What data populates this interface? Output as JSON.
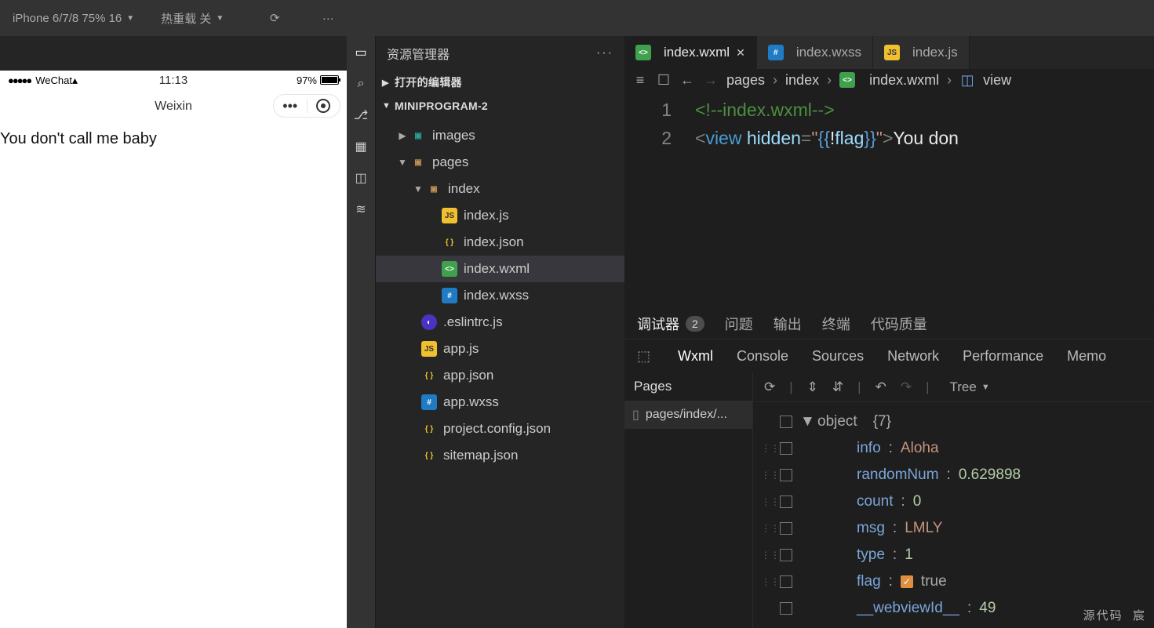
{
  "topbar": {
    "device": "iPhone 6/7/8 75% 16",
    "hotreload": "热重载 关"
  },
  "simulator": {
    "statusbar": {
      "carrier": "WeChat",
      "time": "11:13",
      "battery": "97%"
    },
    "navbar": {
      "title": "Weixin"
    },
    "page_text": "You don't call me baby"
  },
  "explorer": {
    "title": "资源管理器",
    "open_editors": "打开的编辑器",
    "project": "MINIPROGRAM-2",
    "tree": {
      "images": "images",
      "pages": "pages",
      "index_dir": "index",
      "files": {
        "index_js": "index.js",
        "index_json": "index.json",
        "index_wxml": "index.wxml",
        "index_wxss": "index.wxss",
        "eslintrc": ".eslintrc.js",
        "app_js": "app.js",
        "app_json": "app.json",
        "app_wxss": "app.wxss",
        "project_config": "project.config.json",
        "sitemap": "sitemap.json"
      }
    }
  },
  "editor": {
    "tabs": {
      "wxml": "index.wxml",
      "wxss": "index.wxss",
      "js": "index.js"
    },
    "breadcrumb": {
      "p0": "pages",
      "p1": "index",
      "p2": "index.wxml",
      "p3": "view"
    },
    "code": {
      "l1_num": "1",
      "l2_num": "2",
      "l1": "<!--index.wxml-->",
      "l2_pre": "<",
      "l2_tag": "view",
      "l2_sp": " ",
      "l2_attr": "hidden",
      "l2_eq": "=",
      "l2_q1": "\"",
      "l2_bo": "{{",
      "l2_not": "!",
      "l2_flag": "flag",
      "l2_bc": "}}",
      "l2_q2": "\"",
      "l2_gt": ">",
      "l2_txt": "You don"
    }
  },
  "panel": {
    "debugger": "调试器",
    "debugger_badge": "2",
    "problems": "问题",
    "output": "输出",
    "terminal": "终端",
    "codequality": "代码质量"
  },
  "devtools": {
    "tabs": {
      "wxml": "Wxml",
      "console": "Console",
      "sources": "Sources",
      "network": "Network",
      "performance": "Performance",
      "memory": "Memo"
    },
    "pages": "Pages",
    "page_path": "pages/index/...",
    "tree_label": "Tree",
    "object_label": "object",
    "object_count": "{7}",
    "props": {
      "info_k": "info",
      "info_v": "Aloha",
      "randomNum_k": "randomNum",
      "randomNum_v": "0.629898",
      "count_k": "count",
      "count_v": "0",
      "msg_k": "msg",
      "msg_v": "LMLY",
      "type_k": "type",
      "type_v": "1",
      "flag_k": "flag",
      "flag_v": "true",
      "webviewId_k": "__webviewId__",
      "webviewId_v": "49"
    }
  },
  "footer": {
    "source": "源代码",
    "author": "宸"
  }
}
